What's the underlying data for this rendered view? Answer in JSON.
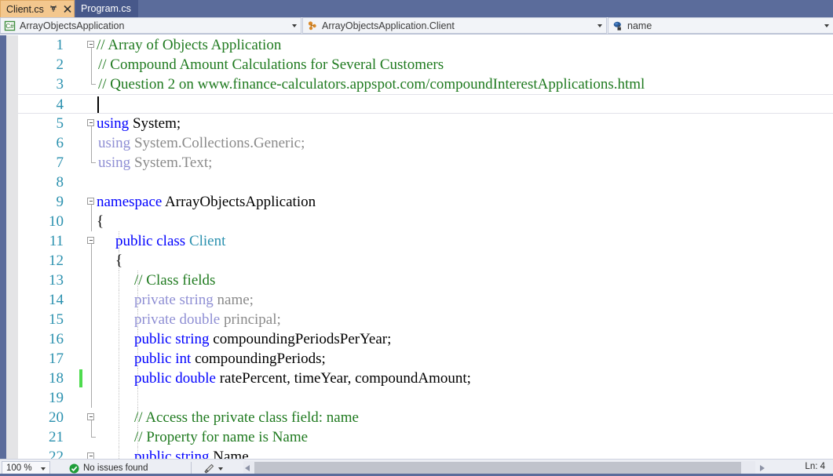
{
  "window": {
    "accent_blue": "#5b6c9b",
    "active_tab_bg": "#f3c78e"
  },
  "tabs": [
    {
      "label": "Client.cs",
      "active": true,
      "pin_icon": "pin-icon",
      "close_icon": "close-icon"
    },
    {
      "label": "Program.cs",
      "active": false
    }
  ],
  "navbar": {
    "project": {
      "label": "ArrayObjectsApplication",
      "icon": "csharp-project-icon"
    },
    "class": {
      "label": "ArrayObjectsApplication.Client",
      "icon": "class-icon"
    },
    "member": {
      "label": "name",
      "icon": "private-field-icon"
    }
  },
  "editor": {
    "lines": [
      {
        "n": 1,
        "tokens": [
          {
            "t": "// Array of Objects Application",
            "c": "cm"
          }
        ]
      },
      {
        "n": 2,
        "tokens": [
          {
            "t": "// Compound Amount Calculations for Several Customers",
            "c": "cm"
          }
        ]
      },
      {
        "n": 3,
        "tokens": [
          {
            "t": "// Question 2 on www.finance-calculators.appspot.com/compoundInterestApplications.html",
            "c": "cm"
          }
        ]
      },
      {
        "n": 4,
        "tokens": []
      },
      {
        "n": 5,
        "tokens": [
          {
            "t": "using",
            "c": "kw"
          },
          {
            "t": " System;",
            "c": "id"
          }
        ]
      },
      {
        "n": 6,
        "tokens": [
          {
            "t": "using",
            "c": "kwf"
          },
          {
            "t": " System.Collections.Generic;",
            "c": "idf"
          }
        ]
      },
      {
        "n": 7,
        "tokens": [
          {
            "t": "using",
            "c": "kwf"
          },
          {
            "t": " System.Text;",
            "c": "idf"
          }
        ]
      },
      {
        "n": 8,
        "tokens": []
      },
      {
        "n": 9,
        "tokens": [
          {
            "t": "namespace",
            "c": "kw"
          },
          {
            "t": " ArrayObjectsApplication",
            "c": "id"
          }
        ]
      },
      {
        "n": 10,
        "tokens": [
          {
            "t": "{",
            "c": "id"
          }
        ]
      },
      {
        "n": 11,
        "tokens": [
          {
            "t": "public class ",
            "c": "kw"
          },
          {
            "t": "Client",
            "c": "ty"
          }
        ]
      },
      {
        "n": 12,
        "tokens": [
          {
            "t": "{",
            "c": "id"
          }
        ]
      },
      {
        "n": 13,
        "tokens": [
          {
            "t": "// Class fields",
            "c": "cm"
          }
        ]
      },
      {
        "n": 14,
        "tokens": [
          {
            "t": "private string ",
            "c": "kwf"
          },
          {
            "t": "name;",
            "c": "idf"
          }
        ]
      },
      {
        "n": 15,
        "tokens": [
          {
            "t": "private double ",
            "c": "kwf"
          },
          {
            "t": "principal;",
            "c": "idf"
          }
        ]
      },
      {
        "n": 16,
        "tokens": [
          {
            "t": "public string ",
            "c": "kw"
          },
          {
            "t": "compoundingPeriodsPerYear;",
            "c": "id"
          }
        ]
      },
      {
        "n": 17,
        "tokens": [
          {
            "t": "public int ",
            "c": "kw"
          },
          {
            "t": "compoundingPeriods;",
            "c": "id"
          }
        ]
      },
      {
        "n": 18,
        "tokens": [
          {
            "t": "public double ",
            "c": "kw"
          },
          {
            "t": "ratePercent, timeYear, compoundAmount;",
            "c": "id"
          }
        ]
      },
      {
        "n": 19,
        "tokens": []
      },
      {
        "n": 20,
        "tokens": [
          {
            "t": "// Access the private class field: name",
            "c": "cm"
          }
        ]
      },
      {
        "n": 21,
        "tokens": [
          {
            "t": "// Property for name is Name",
            "c": "cm"
          }
        ]
      },
      {
        "n": 22,
        "tokens": [
          {
            "t": "public string ",
            "c": "kw"
          },
          {
            "t": "Name",
            "c": "id"
          }
        ]
      }
    ]
  },
  "statusbar": {
    "zoom": "100 %",
    "issues": "No issues found",
    "issues_icon": "green-check-icon",
    "brush_icon": "highlight-brush-icon",
    "line_position": "Ln: 4"
  }
}
